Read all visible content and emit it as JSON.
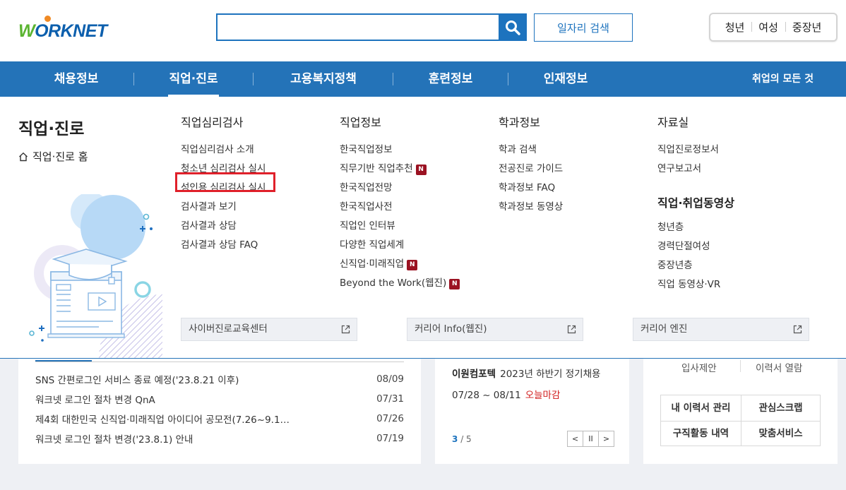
{
  "header": {
    "logo_text": "WORKNET",
    "search_placeholder": "",
    "job_search_label": "일자리 검색",
    "user_tabs": [
      "청년",
      "여성",
      "중장년"
    ]
  },
  "nav": {
    "items": [
      "채용정보",
      "직업·진로",
      "고용복지정책",
      "훈련정보",
      "인재정보"
    ],
    "all_label": "취업의 모든 것",
    "active": "직업·진로"
  },
  "mega": {
    "title": "직업·진로",
    "home_label": "직업·진로 홈",
    "columns": [
      {
        "head": "직업심리검사",
        "items": [
          {
            "label": "직업심리검사 소개",
            "new": false
          },
          {
            "label": "청소년 심리검사 실시",
            "new": false
          },
          {
            "label": "성인용 심리검사 실시",
            "new": false
          },
          {
            "label": "검사결과 보기",
            "new": false
          },
          {
            "label": "검사결과 상담",
            "new": false
          },
          {
            "label": "검사결과 상담 FAQ",
            "new": false
          }
        ]
      },
      {
        "head": "직업정보",
        "items": [
          {
            "label": "한국직업정보",
            "new": false
          },
          {
            "label": "직무기반 직업추천",
            "new": true
          },
          {
            "label": "한국직업전망",
            "new": false
          },
          {
            "label": "한국직업사전",
            "new": false
          },
          {
            "label": "직업인 인터뷰",
            "new": false
          },
          {
            "label": "다양한 직업세계",
            "new": false
          },
          {
            "label": "신직업·미래직업",
            "new": true
          },
          {
            "label": "Beyond the Work(웹진)",
            "new": true
          }
        ]
      },
      {
        "head": "학과정보",
        "items": [
          {
            "label": "학과 검색",
            "new": false
          },
          {
            "label": "전공진로 가이드",
            "new": false
          },
          {
            "label": "학과정보 FAQ",
            "new": false
          },
          {
            "label": "학과정보 동영상",
            "new": false
          }
        ]
      },
      {
        "head": "자료실",
        "items": [
          {
            "label": "직업진로정보서",
            "new": false
          },
          {
            "label": "연구보고서",
            "new": false
          }
        ],
        "head2": "직업·취업동영상",
        "items2": [
          {
            "label": "청년층",
            "new": false
          },
          {
            "label": "경력단절여성",
            "new": false
          },
          {
            "label": "중장년층",
            "new": false
          },
          {
            "label": "직업 동영상·VR",
            "new": false
          }
        ]
      }
    ],
    "badge_label": "N",
    "external_links": [
      "사이버진로교육센터",
      "커리어 Info(웹진)",
      "커리어 엔진"
    ]
  },
  "notices": [
    {
      "title": "SNS 간편로그인 서비스 종료 예정('23.8.21 이후)",
      "date": "08/09"
    },
    {
      "title": "워크넷 로그인 절차 변경 QnA",
      "date": "07/31"
    },
    {
      "title": "제4회 대한민국 신직업·미래직업 아이디어 공모전(7.26~9.1…",
      "date": "07/26"
    },
    {
      "title": "워크넷 로그인 절차 변경('23.8.1) 안내",
      "date": "07/19"
    }
  ],
  "recruit": {
    "company": "이원컴포텍",
    "title": "2023년 하반기 정기채용",
    "period": "07/28 ~ 08/11",
    "deadline": "오늘마감",
    "page_current": "3",
    "page_total": "/ 5",
    "prev_label": "<",
    "pause_label": "II",
    "next_label": ">"
  },
  "my_service": {
    "top_left": "입사제안",
    "top_right": "이력서 열람",
    "grid": [
      "내 이력서 관리",
      "관심스크랩",
      "구직활동 내역",
      "맞춤서비스"
    ]
  },
  "colors": {
    "brand_blue": "#2473b8",
    "logo_green": "#5bb431",
    "badge_red": "#9b1222",
    "highlight_red": "#e0202a"
  }
}
